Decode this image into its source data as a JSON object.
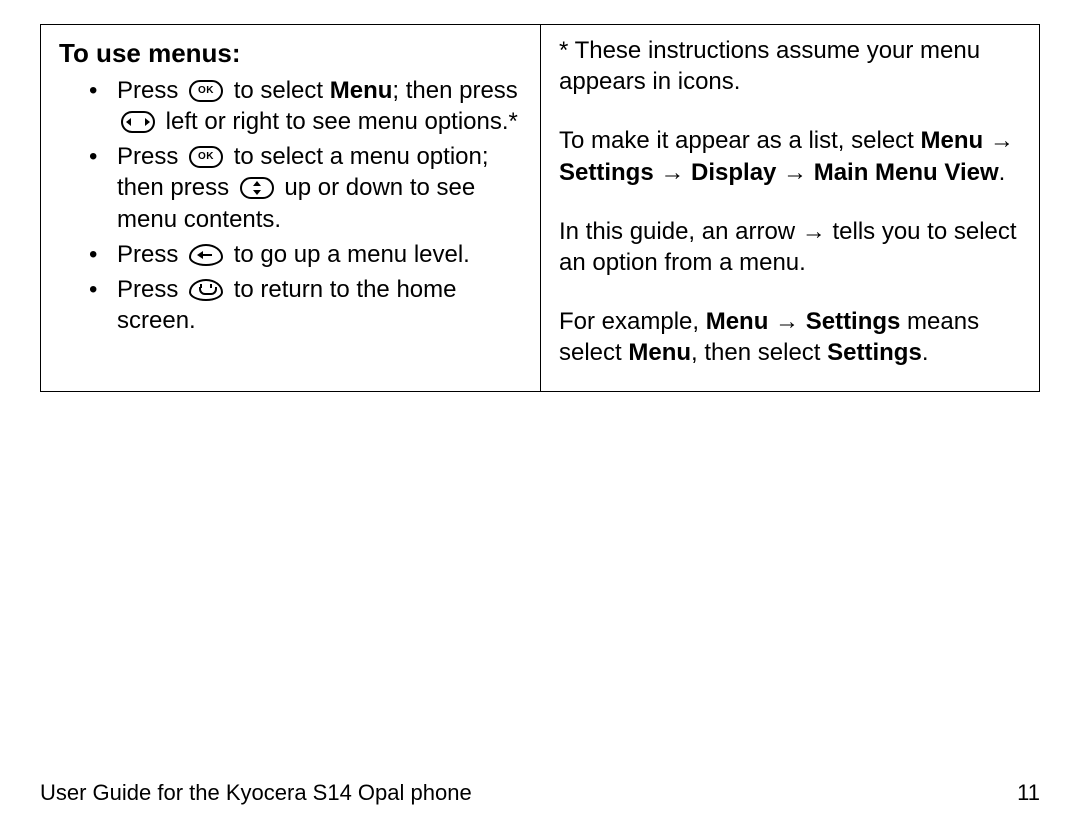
{
  "left": {
    "heading": "To use menus:",
    "items": [
      {
        "pre": "Press ",
        "iconA": "ok",
        "mid1": " to select ",
        "bold1": "Menu",
        "mid2": "; then press ",
        "iconB": "nav-lr",
        "post": " left or right to see menu options.*"
      },
      {
        "pre": "Press ",
        "iconA": "ok",
        "mid1": " to select a menu option; then press ",
        "iconB": "nav-ud",
        "post": " up or down to see menu contents."
      },
      {
        "pre": "Press ",
        "iconA": "back",
        "post": " to go up a menu level."
      },
      {
        "pre": "Press ",
        "iconA": "end",
        "post": " to return to the home screen."
      }
    ]
  },
  "right": {
    "p1": "* These instructions assume your menu appears in icons.",
    "p2": {
      "t1": "To make it appear as a list, select ",
      "b1": "Menu → Settings → Display → Main Menu View",
      "t2": "."
    },
    "p3": "In this guide, an arrow → tells you to select an option from a menu.",
    "p4": {
      "t1": "For example, ",
      "b1": "Menu → Settings",
      "t2": " means select ",
      "b2": "Menu",
      "t3": ", then select ",
      "b3": "Settings",
      "t4": "."
    }
  },
  "footer": {
    "left": "User Guide for the Kyocera S14 Opal phone",
    "right": "11"
  }
}
